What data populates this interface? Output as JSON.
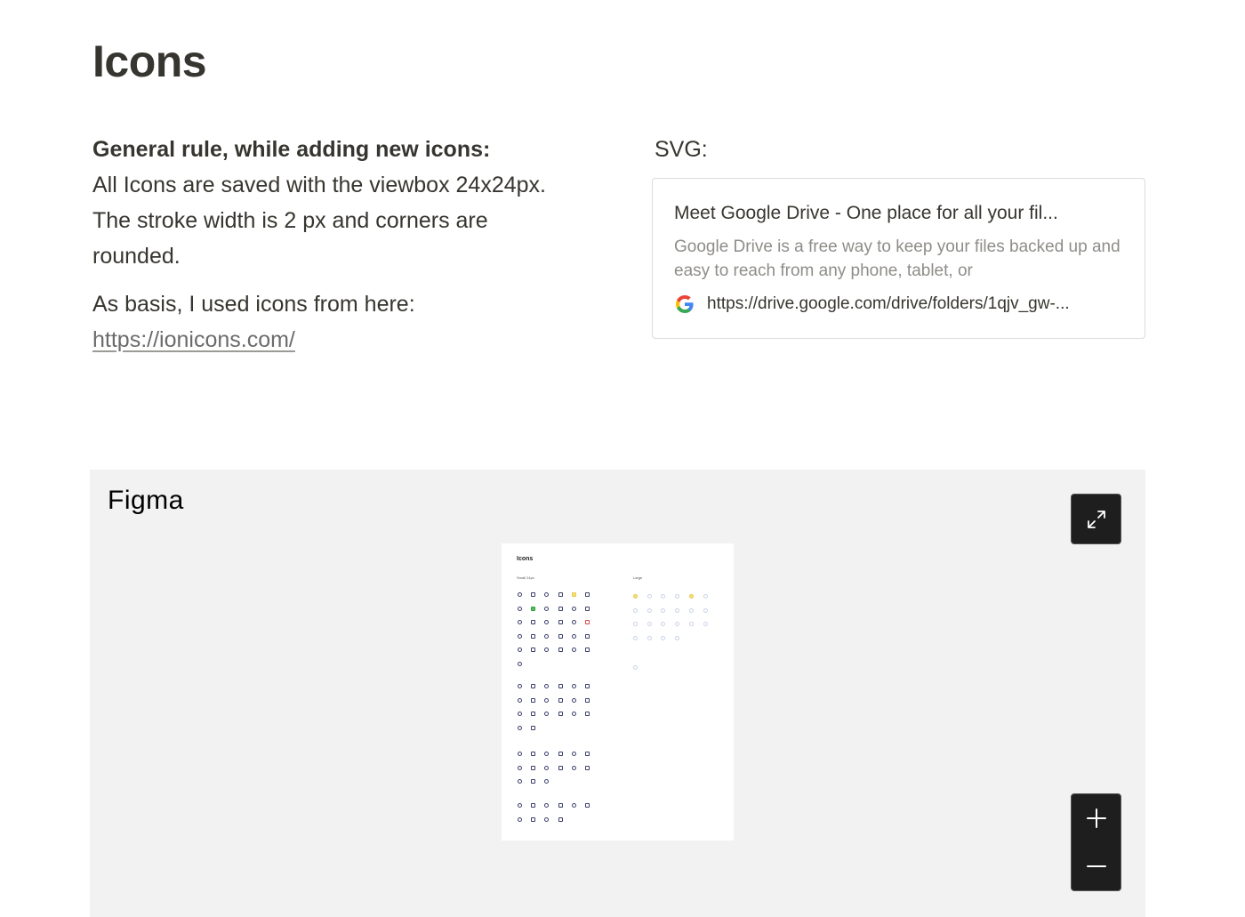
{
  "page": {
    "title": "Icons"
  },
  "rules": {
    "heading": "General rule, while adding new icons:",
    "line1": "All Icons are saved with the viewbox 24x24px.",
    "line2": "The stroke width is 2 px and corners are rounded.",
    "basis_text": "As basis, I used icons from here:",
    "basis_link": "https://ionicons.com/"
  },
  "svg_section": {
    "label": "SVG:",
    "bookmark": {
      "title": "Meet Google Drive - One place for all your fil...",
      "description": "Google Drive is a free way to keep your files backed up and easy to reach from any phone, tablet, or",
      "url": "https://drive.google.com/drive/folders/1qjv_gw-...",
      "favicon": "google-g-icon"
    }
  },
  "figma_embed": {
    "logo_text": "Figma",
    "expand_icon": "expand-arrows-icon",
    "zoom_in_icon": "plus-icon",
    "zoom_out_icon": "minus-icon",
    "frame": {
      "title": "Icons",
      "small_label": "Small 24px",
      "large_label": "Large"
    }
  }
}
